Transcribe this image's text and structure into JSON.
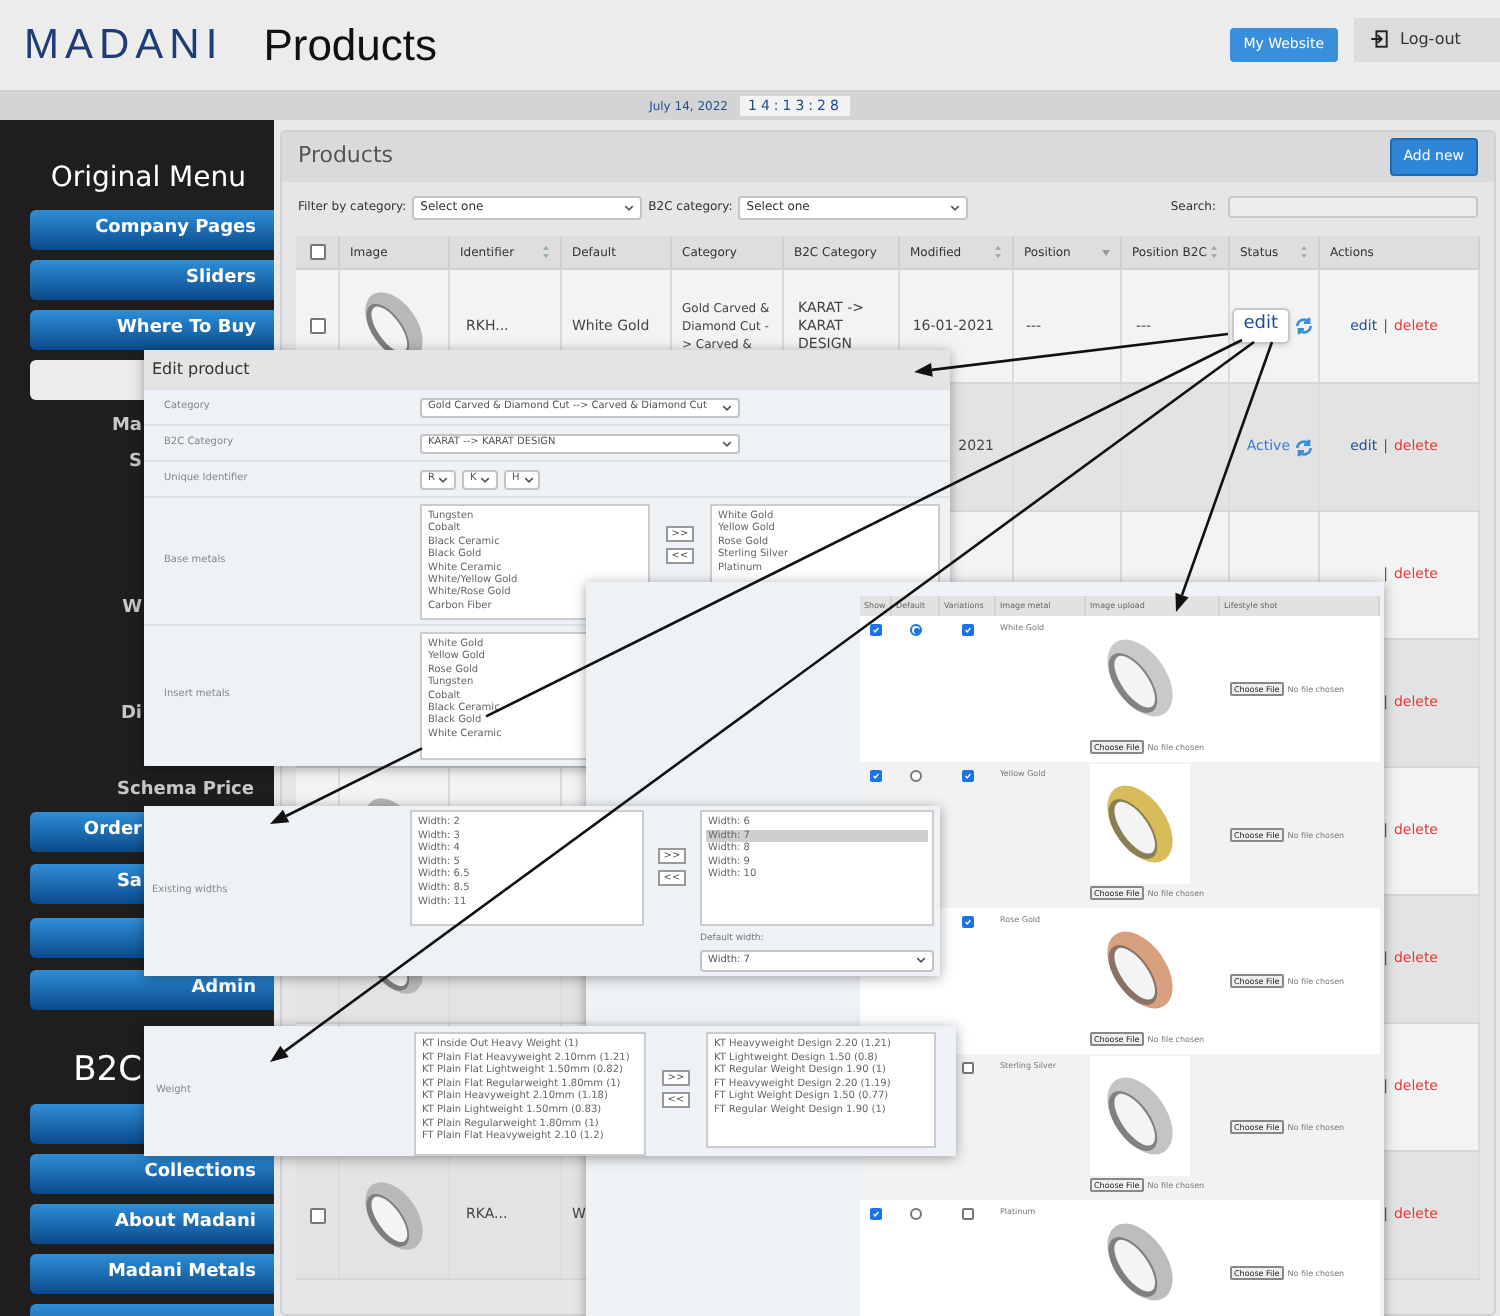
{
  "header": {
    "logo": "MADANI",
    "title": "Products",
    "my_website_button": "My Website",
    "logout_button": "Log-out"
  },
  "datebar": {
    "date": "July 14, 2022",
    "time": "14:13:28"
  },
  "sidebar": {
    "items": [
      {
        "kind": "heading",
        "text": "Original Menu"
      },
      {
        "kind": "button",
        "text": "Company Pages"
      },
      {
        "kind": "button",
        "text": "Sliders"
      },
      {
        "kind": "button",
        "text": "Where To Buy"
      },
      {
        "kind": "light"
      },
      {
        "kind": "text_cut",
        "text": "Ma"
      },
      {
        "kind": "text_cut",
        "text": "S"
      },
      {
        "kind": "text_cut",
        "text": "W"
      },
      {
        "kind": "text_cut",
        "text": "Di"
      },
      {
        "kind": "text",
        "text": "Schema Price"
      },
      {
        "kind": "button_cut",
        "text": "Order"
      },
      {
        "kind": "button_cut",
        "text": "Sa"
      },
      {
        "kind": "blank"
      },
      {
        "kind": "button",
        "text": "Admin"
      },
      {
        "kind": "heading_cut",
        "text": "B2C"
      },
      {
        "kind": "blank"
      },
      {
        "kind": "button",
        "text": "Collections"
      },
      {
        "kind": "button",
        "text": "About Madani"
      },
      {
        "kind": "button",
        "text": "Madani Metals"
      },
      {
        "kind": "blank"
      }
    ]
  },
  "products_panel": {
    "title": "Products",
    "add_button": "Add new",
    "filters": {
      "category_label": "Filter by category:",
      "category_value": "Select one",
      "b2c_label": "B2C category:",
      "b2c_value": "Select one",
      "search_label": "Search:"
    },
    "table": {
      "select_all_checked": false,
      "columns": [
        {
          "label": "Image"
        },
        {
          "label": "Identifier",
          "sortable": true
        },
        {
          "label": "Default"
        },
        {
          "label": "Category"
        },
        {
          "label": "B2C Category"
        },
        {
          "label": "Modified",
          "sortable": true
        },
        {
          "label": "Position",
          "sortable": true,
          "sorted": true
        },
        {
          "label": "Position B2C",
          "sortable": true
        },
        {
          "label": "Status",
          "sortable": true
        },
        {
          "label": "Actions"
        }
      ],
      "rows": [
        {
          "checked": false,
          "identifier": "RKH...",
          "default": "White Gold",
          "category": "Gold Carved &\nDiamond Cut -\n> Carved &",
          "b2c_category": "KARAT -> KARAT DESIGN",
          "modified": "16-01-2021",
          "position": "---",
          "position_b2c": "---",
          "status": {
            "text": "edit",
            "highlighted": true
          },
          "actions": {
            "edit": "edit",
            "separator": "|",
            "delete": "delete"
          }
        },
        {
          "modified": "2021",
          "status": {
            "text": "Active",
            "highlighted": false
          },
          "actions": {
            "edit": "edit",
            "separator": "|",
            "delete": "delete"
          }
        },
        {
          "actions": {
            "separator": "|",
            "delete": "delete"
          }
        },
        {
          "actions": {
            "separator": "|",
            "delete": "delete"
          }
        },
        {
          "actions": {
            "separator": "|",
            "delete": "delete"
          }
        },
        {
          "actions": {
            "separator": "|",
            "delete": "delete"
          }
        },
        {
          "actions": {
            "separator": "|",
            "delete": "delete"
          }
        },
        {
          "checked": false,
          "identifier": "RKA...",
          "default": "W",
          "actions": {
            "separator": "|",
            "delete": "delete"
          }
        }
      ]
    }
  },
  "edit_product_dialog": {
    "title": "Edit product",
    "fields": [
      {
        "kind": "select",
        "label": "Category",
        "value": "Gold Carved & Diamond Cut --> Carved & Diamond Cut"
      },
      {
        "kind": "select",
        "label": "B2C Category",
        "value": "KARAT --> KARAT DESIGN"
      },
      {
        "kind": "triple",
        "label": "Unique Identifier",
        "values": [
          "R",
          "K",
          "H"
        ]
      },
      {
        "kind": "dual_list",
        "label": "Base metals",
        "available": [
          "Tungsten",
          "Cobalt",
          "Black Ceramic",
          "Black Gold",
          "White Ceramic",
          "White/Yellow Gold",
          "White/Rose Gold",
          "Carbon Fiber"
        ],
        "chosen": [
          "White Gold",
          "Yellow Gold",
          "Rose Gold",
          "Sterling Silver",
          "Platinum"
        ],
        "add": ">>",
        "remove": "<<"
      },
      {
        "kind": "single_list",
        "label": "Insert metals",
        "available": [
          "White Gold",
          "Yellow Gold",
          "Rose Gold",
          "Tungsten",
          "Cobalt",
          "Black Ceramic",
          "Black Gold",
          "White Ceramic"
        ]
      }
    ]
  },
  "variants_dialog": {
    "columns": [
      "Show",
      "Default",
      "Variations",
      "Image metal",
      "Image upload",
      "Lifestyle shot"
    ],
    "rows": [
      {
        "show": true,
        "selected": true,
        "variations": true,
        "metal": "White Gold",
        "color": "#c9c9c9",
        "upload_button": "Choose File",
        "upload_status": "No file chosen",
        "lifestyle_button": "Choose File",
        "lifestyle_status": "No file chosen"
      },
      {
        "show": true,
        "selected": false,
        "variations": true,
        "metal": "Yellow Gold",
        "color": "#d8bc5a",
        "upload_button": "Choose File",
        "upload_status": "No file chosen",
        "lifestyle_button": "Choose File",
        "lifestyle_status": "No file chosen"
      },
      {
        "variations": true,
        "metal": "Rose Gold",
        "color": "#d9a07f",
        "upload_button": "Choose File",
        "upload_status": "No file chosen",
        "lifestyle_button": "Choose File",
        "lifestyle_status": "No file chosen"
      },
      {
        "variations": false,
        "metal": "Sterling Silver",
        "color": "#c4c4c4",
        "upload_button": "Choose File",
        "upload_status": "No file chosen",
        "lifestyle_button": "Choose File",
        "lifestyle_status": "No file chosen"
      },
      {
        "show": true,
        "selected": false,
        "variations": false,
        "metal": "Platinum",
        "color": "#bdbdbd",
        "lifestyle_button": "Choose File",
        "lifestyle_status": "No file chosen"
      }
    ]
  },
  "widths_dialog": {
    "label": "Existing widths",
    "available": [
      {
        "text": "Width: 2",
        "selected": false
      },
      {
        "text": "Width: 3",
        "selected": false
      },
      {
        "text": "Width: 4",
        "selected": false
      },
      {
        "text": "Width: 5",
        "selected": false
      },
      {
        "text": "Width: 6.5",
        "selected": false
      },
      {
        "text": "Width: 8.5",
        "selected": false
      },
      {
        "text": "Width: 11",
        "selected": false
      }
    ],
    "chosen": [
      {
        "text": "Width: 6",
        "selected": false
      },
      {
        "text": "Width: 7",
        "selected": true
      },
      {
        "text": "Width: 8",
        "selected": false
      },
      {
        "text": "Width: 9",
        "selected": false
      },
      {
        "text": "Width: 10",
        "selected": false
      }
    ],
    "add": ">>",
    "remove": "<<",
    "default_label": "Default width:",
    "default_value": "Width: 7"
  },
  "weight_dialog": {
    "label": "Weight",
    "available": [
      "KT Inside Out Heavy Weight (1)",
      "KT Plain Flat Heavyweight 2.10mm (1.21)",
      "KT Plain Flat Lightweight 1.50mm (0.82)",
      "KT Plain Flat Regularweight 1.80mm (1)",
      "KT Plain Heavyweight 2.10mm (1.18)",
      "KT Plain Lightweight 1.50mm (0.83)",
      "KT Plain Regularweight 1.80mm (1)",
      "FT Plain Flat Heavyweight 2.10 (1.2)"
    ],
    "chosen": [
      "KT Heavyweight Design 2.20 (1.21)",
      "KT Lightweight Design 1.50 (0.8)",
      "KT Regular Weight Design 1.90 (1)",
      "FT Heavyweight Design 2.20 (1.19)",
      "FT Light Weight Design 1.50 (0.77)",
      "FT Regular Weight Design 1.90 (1)"
    ],
    "add": ">>",
    "remove": "<<"
  }
}
